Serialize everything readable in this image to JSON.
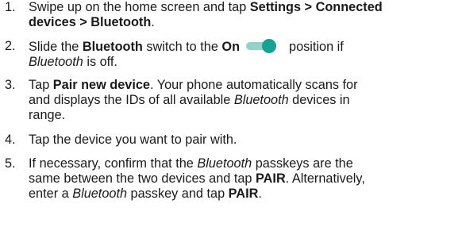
{
  "steps": [
    {
      "number": "1.",
      "lines": [
        [
          {
            "t": "Swipe up on the home screen and tap ",
            "s": "n"
          },
          {
            "t": "Settings > Connected",
            "s": "b"
          }
        ],
        [
          {
            "t": "devices > Bluetooth",
            "s": "b"
          },
          {
            "t": ".",
            "s": "n"
          }
        ]
      ]
    },
    {
      "number": "2.",
      "lines": [
        [
          {
            "t": "Slide the ",
            "s": "n"
          },
          {
            "t": "Bluetooth",
            "s": "b"
          },
          {
            "t": " switch to the ",
            "s": "n"
          },
          {
            "t": "On",
            "s": "b"
          },
          {
            "toggle": true,
            "state": "on"
          },
          {
            "t": "position if",
            "s": "n"
          }
        ],
        [
          {
            "t": "Bluetooth",
            "s": "i"
          },
          {
            "t": " is off.",
            "s": "n"
          }
        ]
      ]
    },
    {
      "number": "3.",
      "lines": [
        [
          {
            "t": "Tap ",
            "s": "n"
          },
          {
            "t": "Pair new device",
            "s": "b"
          },
          {
            "t": ". Your phone automatically scans for",
            "s": "n"
          }
        ],
        [
          {
            "t": "and displays the IDs of all available ",
            "s": "n"
          },
          {
            "t": "Bluetooth",
            "s": "i"
          },
          {
            "t": " devices in",
            "s": "n"
          }
        ],
        [
          {
            "t": "range.",
            "s": "n"
          }
        ]
      ]
    },
    {
      "number": "4.",
      "lines": [
        [
          {
            "t": "Tap the device you want to pair with.",
            "s": "n"
          }
        ]
      ]
    },
    {
      "number": "5.",
      "lines": [
        [
          {
            "t": "If necessary, confirm that the ",
            "s": "n"
          },
          {
            "t": "Bluetooth",
            "s": "i"
          },
          {
            "t": " passkeys are the",
            "s": "n"
          }
        ],
        [
          {
            "t": "same between the two devices and tap ",
            "s": "n"
          },
          {
            "t": "PAIR",
            "s": "b"
          },
          {
            "t": ". Alternatively,",
            "s": "n"
          }
        ],
        [
          {
            "t": "enter a ",
            "s": "n"
          },
          {
            "t": "Bluetooth",
            "s": "i"
          },
          {
            "t": " passkey and tap ",
            "s": "n"
          },
          {
            "t": "PAIR",
            "s": "b"
          },
          {
            "t": ".",
            "s": "n"
          }
        ]
      ]
    }
  ],
  "colors": {
    "text": "#1a1a1a",
    "toggle_track": "#8fd3c9",
    "toggle_knob": "#16a394"
  },
  "icons": {
    "toggle": "toggle-switch-on-icon"
  }
}
